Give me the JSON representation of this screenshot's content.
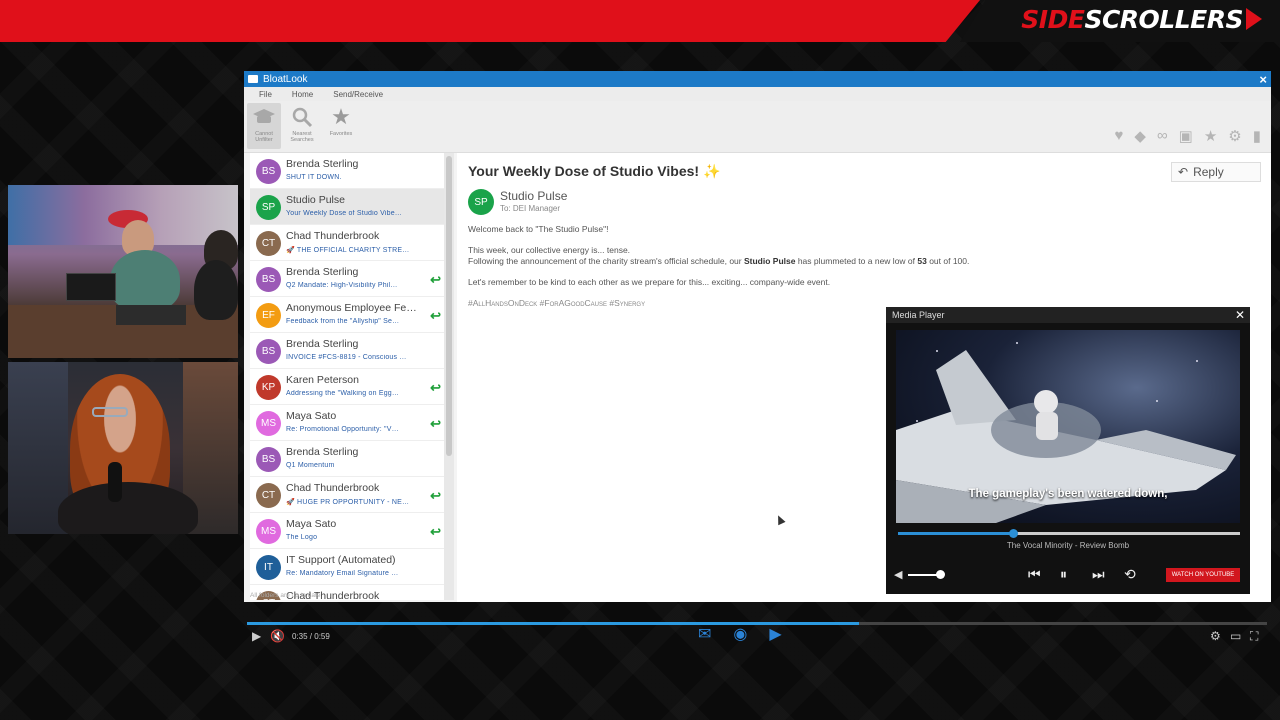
{
  "banner": {
    "logo_left": "SIDE",
    "logo_right": "SCROLLERS",
    "colors": {
      "red": "#e0101a",
      "dark": "#111111"
    }
  },
  "app": {
    "window_title": "BloatLook",
    "menu": [
      "File",
      "Home",
      "Send/Receive"
    ],
    "ribbon": [
      {
        "label": "Cannot Unfilter",
        "icon": "mortarboard-icon"
      },
      {
        "label": "Nearest Searches",
        "icon": "magnifier-icon"
      },
      {
        "label": "Favorites",
        "icon": "star-icon"
      }
    ],
    "toolbar_icons": [
      "heart-icon",
      "tag-icon",
      "link-icon",
      "bookmark-icon",
      "star-icon",
      "settings-icon",
      "trash-icon"
    ],
    "messages": [
      {
        "initials": "BS",
        "sender": "Brenda Sterling",
        "subject": "SHUT IT DOWN.",
        "color": "#9b59b6",
        "replied": false
      },
      {
        "initials": "SP",
        "sender": "Studio Pulse",
        "subject": "Your Weekly Dose of Studio Vibe…",
        "color": "#1aa34a",
        "replied": false,
        "selected": true
      },
      {
        "initials": "CT",
        "sender": "Chad Thunderbrook",
        "subject": "🚀 THE OFFICIAL CHARITY STRE…",
        "color": "#8a6a4f",
        "replied": false
      },
      {
        "initials": "BS",
        "sender": "Brenda Sterling",
        "subject": "Q2 Mandate: High-Visibility Phil…",
        "color": "#9b59b6",
        "replied": true
      },
      {
        "initials": "EF",
        "sender": "Anonymous Employee Fe…",
        "subject": "Feedback from the \"Allyship\" Se…",
        "color": "#f39c12",
        "replied": true
      },
      {
        "initials": "BS",
        "sender": "Brenda Sterling",
        "subject": "INVOICE #FCS-8819 - Conscious …",
        "color": "#9b59b6",
        "replied": false
      },
      {
        "initials": "KP",
        "sender": "Karen Peterson",
        "subject": "Addressing the \"Walking on Egg…",
        "color": "#c0392b",
        "replied": true
      },
      {
        "initials": "MS",
        "sender": "Maya Sato",
        "subject": "Re: Promotional Opportunity: \"V…",
        "color": "#e06adf",
        "replied": true
      },
      {
        "initials": "BS",
        "sender": "Brenda Sterling",
        "subject": "Q1 Momentum",
        "color": "#9b59b6",
        "replied": false
      },
      {
        "initials": "CT",
        "sender": "Chad Thunderbrook",
        "subject": "🚀 HUGE PR OPPORTUNITY - NE…",
        "color": "#8a6a4f",
        "replied": true
      },
      {
        "initials": "MS",
        "sender": "Maya Sato",
        "subject": "The Logo",
        "color": "#e06adf",
        "replied": true
      },
      {
        "initials": "IT",
        "sender": "IT Support (Automated)",
        "subject": "Re: Mandatory Email Signature …",
        "color": "#1f5f99",
        "replied": false
      },
      {
        "initials": "CT",
        "sender": "Chad Thunderbrook",
        "subject": "",
        "color": "#8a6a4f",
        "replied": true
      }
    ],
    "reading": {
      "subject": "Your Weekly Dose of Studio Vibes!",
      "sparkle": "✨",
      "reply_label": "Reply",
      "from_initials": "SP",
      "from_name": "Studio Pulse",
      "to": "To: DEI Manager",
      "greeting": "Welcome back to \"The Studio Pulse\"!",
      "line1": "This week, our collective energy is... tense.",
      "line2_pre": "Following the announcement of the charity stream's official schedule, our ",
      "line2_bold1": "Studio Pulse",
      "line2_mid": " has plummeted to a new low of ",
      "line2_bold2": "53",
      "line2_post": " out of 100.",
      "line3": "Let's remember to be kind to each other as we prepare for this... exciting... company-wide event.",
      "tags": "#AllHandsOnDeck #ForAGoodCause #Synergy"
    },
    "status": "All folders are up to date"
  },
  "media_player": {
    "title": "Media Player",
    "caption": "The gameplay's been watered down,",
    "track": "The Vocal Minority - Review Bomb",
    "youtube_label": "WATCH ON YOUTUBE",
    "progress": 0.34,
    "volume": 0.9
  },
  "stream_controls": {
    "time": "0:35 / 0:59",
    "progress": 0.6
  }
}
